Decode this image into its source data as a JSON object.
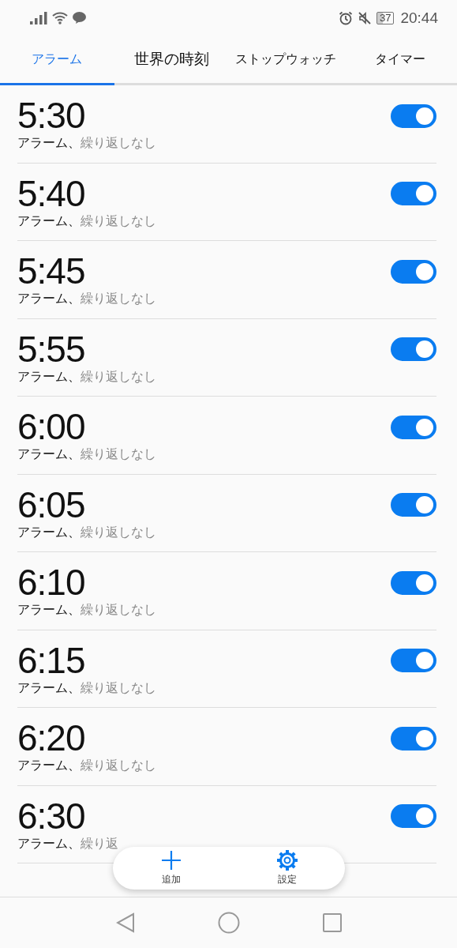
{
  "status_bar": {
    "time": "20:44",
    "battery": "37"
  },
  "tabs": [
    {
      "label": "アラーム",
      "selected": true
    },
    {
      "label": "世界の時刻",
      "selected": false
    },
    {
      "label": "ストップウォッチ",
      "selected": false
    },
    {
      "label": "タイマー",
      "selected": false
    }
  ],
  "alarms": [
    {
      "time": "5:30",
      "label": "アラーム、",
      "repeat": "繰り返しなし",
      "on": true
    },
    {
      "time": "5:40",
      "label": "アラーム、",
      "repeat": "繰り返しなし",
      "on": true
    },
    {
      "time": "5:45",
      "label": "アラーム、",
      "repeat": "繰り返しなし",
      "on": true
    },
    {
      "time": "5:55",
      "label": "アラーム、",
      "repeat": "繰り返しなし",
      "on": true
    },
    {
      "time": "6:00",
      "label": "アラーム、",
      "repeat": "繰り返しなし",
      "on": true
    },
    {
      "time": "6:05",
      "label": "アラーム、",
      "repeat": "繰り返しなし",
      "on": true
    },
    {
      "time": "6:10",
      "label": "アラーム、",
      "repeat": "繰り返しなし",
      "on": true
    },
    {
      "time": "6:15",
      "label": "アラーム、",
      "repeat": "繰り返しなし",
      "on": true
    },
    {
      "time": "6:20",
      "label": "アラーム、",
      "repeat": "繰り返しなし",
      "on": true
    },
    {
      "time": "6:30",
      "label": "アラーム、",
      "repeat": "繰り返",
      "on": true
    }
  ],
  "actions": [
    {
      "kind": "add",
      "label": "追加"
    },
    {
      "kind": "settings",
      "label": "設定"
    }
  ]
}
